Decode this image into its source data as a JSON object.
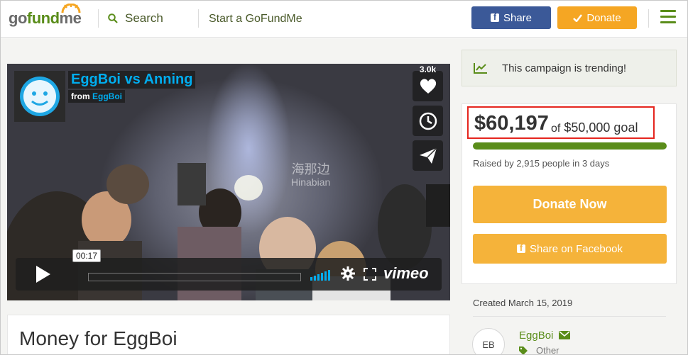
{
  "header": {
    "logo": {
      "go": "go",
      "fund": "fund",
      "me": "me"
    },
    "search_label": "Search",
    "start_label": "Start a GoFundMe",
    "share_label": "Share",
    "donate_label": "Donate"
  },
  "video": {
    "title": "EggBoi vs Anning",
    "from_prefix": "from",
    "from_name": "EggBoi",
    "like_count": "3.0k",
    "timestamp": "00:17",
    "player_brand": "vimeo",
    "watermark_cn": "海那边",
    "watermark_en": "Hinabian"
  },
  "campaign": {
    "title": "Money for EggBoi"
  },
  "sidebar": {
    "trending_text": "This campaign is trending!",
    "amount": "$60,197",
    "goal_prefix": "of",
    "goal_value": "$50,000 goal",
    "progress": 1.0,
    "raised_text": "Raised by 2,915 people in 3 days",
    "donate_now_label": "Donate Now",
    "share_fb_label": "Share on Facebook",
    "created_text": "Created March 15, 2019",
    "organizer_initials": "EB",
    "organizer_name": "EggBoi",
    "organizer_category": "Other"
  },
  "colors": {
    "brand_green": "#5a8d1a",
    "facebook_blue": "#3b5998",
    "donate_orange": "#f5b33a",
    "highlight_red": "#e5251e",
    "vimeo_blue": "#00adef"
  }
}
